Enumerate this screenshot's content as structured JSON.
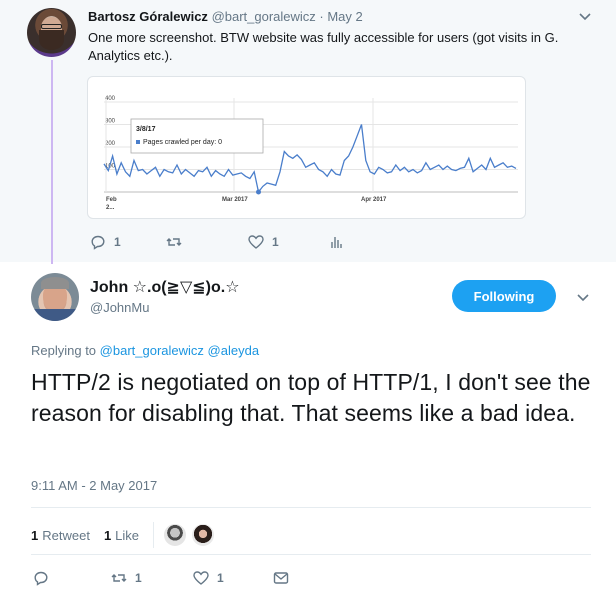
{
  "parent_tweet": {
    "name": "Bartosz Góralewicz",
    "handle_date": "@bart_goralewicz · May 2",
    "text": "One more screenshot. BTW website was fully accessible for users (got visits in G. Analytics etc.).",
    "actions": {
      "reply_count": "1",
      "retweet_count": "",
      "like_count": "1"
    },
    "avatar_icon": "user-avatar-bartosz"
  },
  "chart_data": {
    "type": "line",
    "title": "",
    "xlabel": "",
    "ylabel": "",
    "y_ticks": [
      "400",
      "300",
      "200",
      "100"
    ],
    "x_ticks": [
      "Feb 2...",
      "Mar 2017",
      "Apr 2017"
    ],
    "ylim": [
      0,
      400
    ],
    "grid": true,
    "line_color": "#4a7ecb",
    "tooltip": {
      "date": "3/8/17",
      "label": "Pages crawled per day:",
      "value": "0"
    },
    "series": [
      {
        "values": [
          125,
          95,
          160,
          80,
          130,
          90,
          70,
          140,
          95,
          100,
          80,
          95,
          110,
          70,
          100,
          90,
          85,
          120,
          80,
          100,
          85,
          70,
          95,
          90,
          110,
          70,
          95,
          80,
          70,
          100,
          75,
          80,
          85,
          70,
          60,
          90,
          0,
          25,
          40,
          35,
          30,
          90,
          180,
          160,
          150,
          165,
          145,
          110,
          120,
          130,
          100,
          90,
          70,
          100,
          80,
          75,
          140,
          160,
          200,
          250,
          300,
          140,
          90,
          80,
          110,
          100,
          85,
          90,
          120,
          95,
          110,
          90,
          100,
          85,
          95,
          130,
          100,
          110,
          120,
          100,
          115,
          100,
          95,
          105,
          110,
          150,
          90,
          105,
          120,
          100,
          150,
          110,
          120,
          130,
          110,
          115,
          105
        ]
      }
    ]
  },
  "main_tweet": {
    "name": "John ☆.o(≧▽≦)o.☆",
    "handle": "@JohnMu",
    "follow_label": "Following",
    "reply_prefix": "Replying to",
    "reply_user1": "@bart_goralewicz",
    "reply_user2": "@aleyda",
    "text": "HTTP/2 is negotiated on top of HTTP/1, I don't see the reason for disabling that. That seems like a bad idea.",
    "timestamp": "9:11 AM - 2 May 2017",
    "retweets_count": "1",
    "retweets_label": "Retweet",
    "likes_count": "1",
    "likes_label": "Like",
    "actions": {
      "reply_count": "",
      "retweet_count": "1",
      "like_count": "1"
    },
    "accent_color": "#1da1f2"
  }
}
